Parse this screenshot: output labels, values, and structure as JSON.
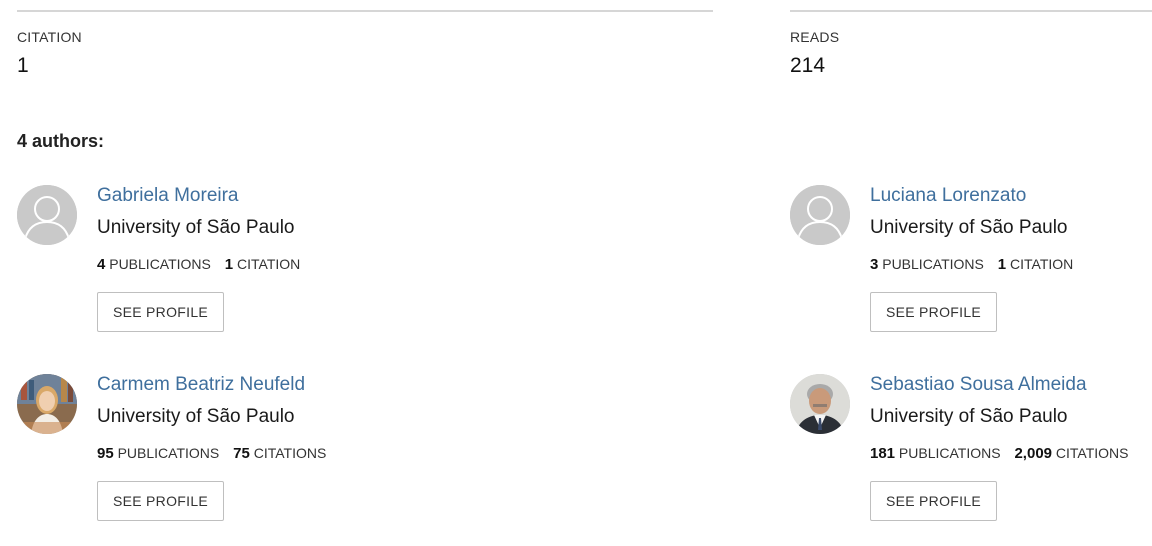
{
  "stats": {
    "citation_label": "CITATION",
    "citation_value": "1",
    "reads_label": "READS",
    "reads_value": "214"
  },
  "authors_heading": "4 authors:",
  "authors": [
    {
      "name": "Gabriela Moreira",
      "institution": "University of São Paulo",
      "publications": "4",
      "publications_label": "PUBLICATIONS",
      "citations": "1",
      "citations_label": "CITATION",
      "button": "SEE PROFILE",
      "avatar": "placeholder-avatar-icon"
    },
    {
      "name": "Luciana Lorenzato",
      "institution": "University of São Paulo",
      "publications": "3",
      "publications_label": "PUBLICATIONS",
      "citations": "1",
      "citations_label": "CITATION",
      "button": "SEE PROFILE",
      "avatar": "placeholder-avatar-icon"
    },
    {
      "name": "Carmem Beatriz Neufeld",
      "institution": "University of São Paulo",
      "publications": "95",
      "publications_label": "PUBLICATIONS",
      "citations": "75",
      "citations_label": "CITATIONS",
      "button": "SEE PROFILE",
      "avatar": "profile-photo"
    },
    {
      "name": "Sebastiao Sousa Almeida",
      "institution": "University of São Paulo",
      "publications": "181",
      "publications_label": "PUBLICATIONS",
      "citations": "2,009",
      "citations_label": "CITATIONS",
      "button": "SEE PROFILE",
      "avatar": "profile-photo"
    }
  ],
  "colors": {
    "link": "#3f6f9d",
    "rule": "#d6d6d6",
    "placeholder_avatar": "#c9c9c9"
  }
}
